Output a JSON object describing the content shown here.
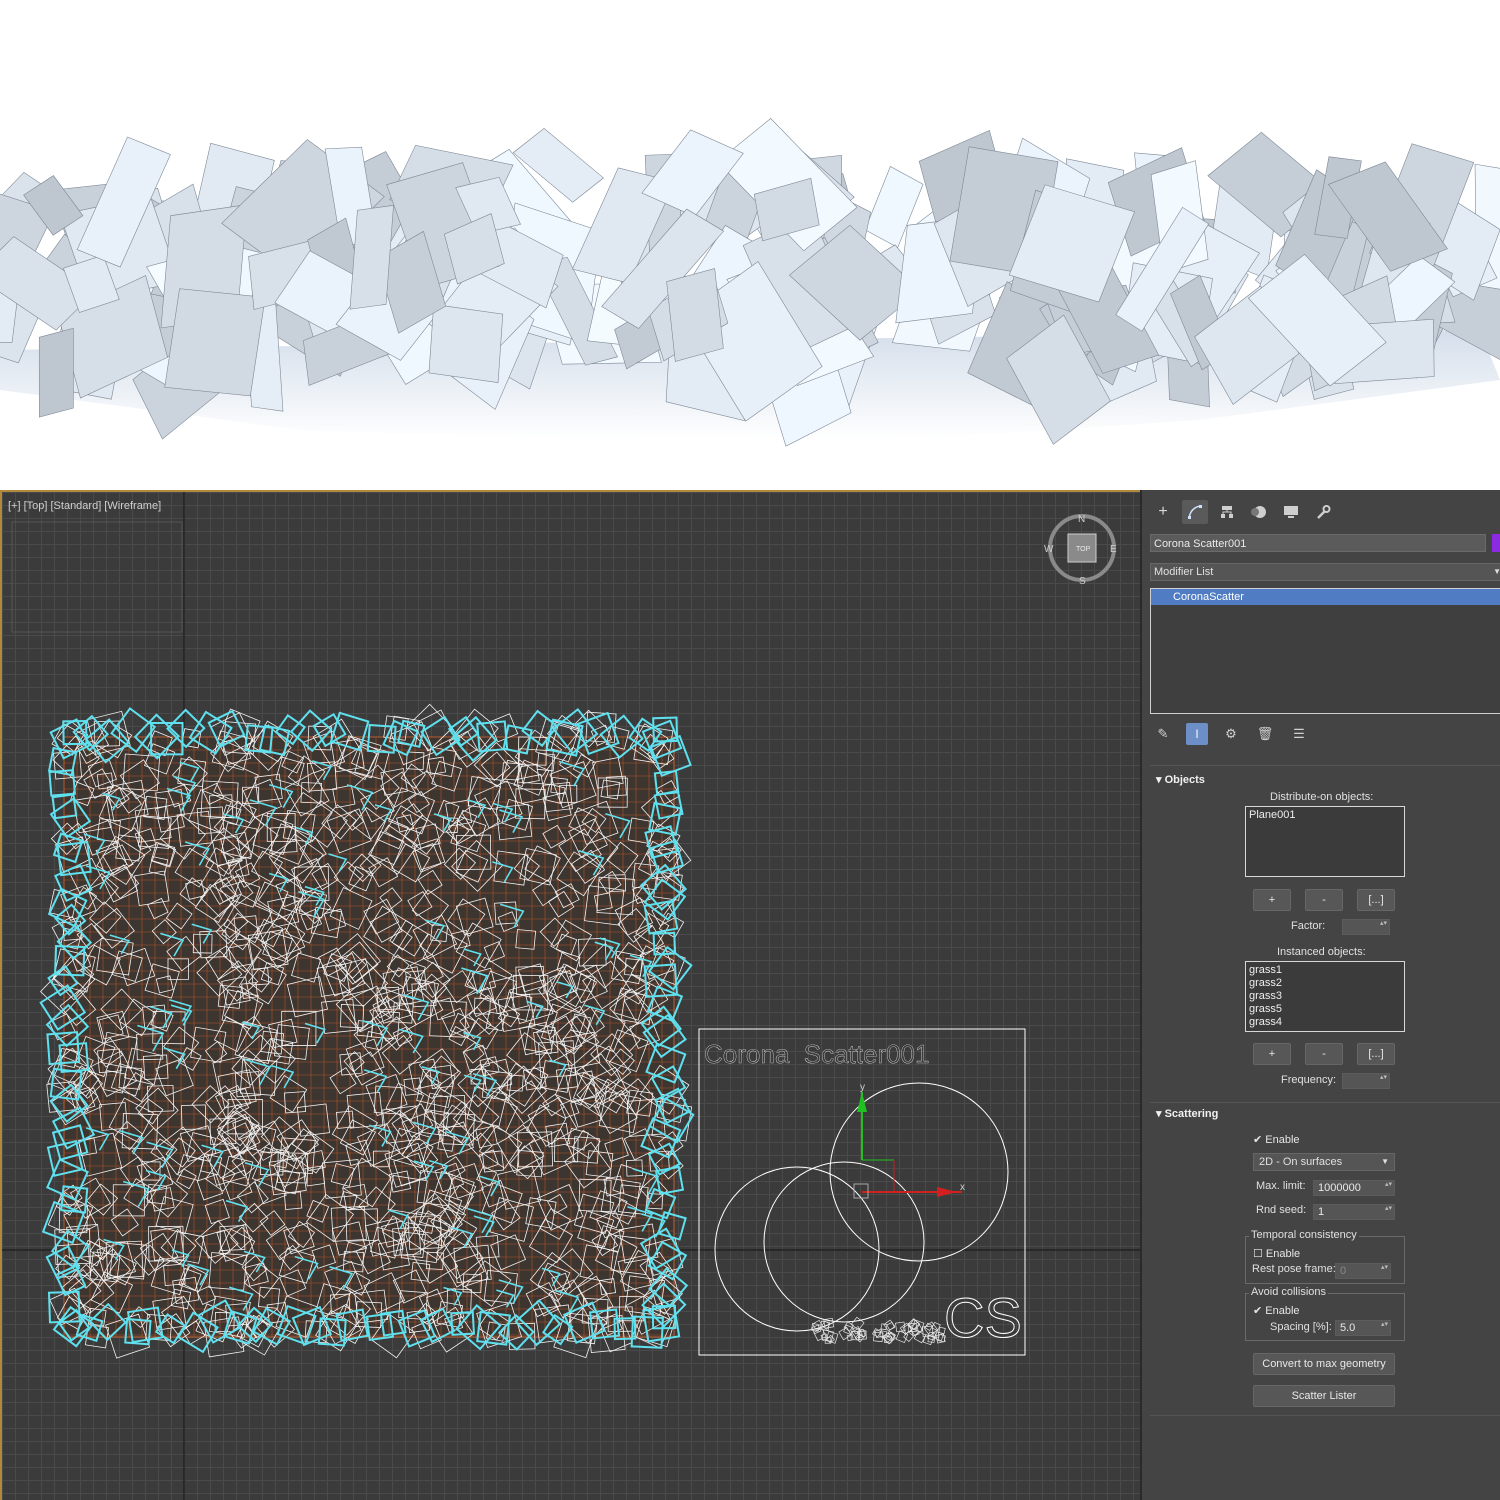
{
  "viewport": {
    "label": "[+] [Top] [Standard] [Wireframe]",
    "viewcube": {
      "n": "N",
      "s": "S",
      "e": "E",
      "w": "W",
      "face": "TOP"
    },
    "icon_title": "Corona  Scatter001",
    "icon_logo": "CS",
    "axis_x": "x",
    "axis_y": "y"
  },
  "panel": {
    "tabs": [
      "create-icon",
      "modify-icon",
      "hierarchy-icon",
      "motion-icon",
      "display-icon",
      "utilities-icon"
    ],
    "object_name": "Corona Scatter001",
    "object_color": "#8a2be2",
    "modifier_list": "Modifier List",
    "stack_item": "CoronaScatter",
    "objects": {
      "title": "Objects",
      "distribute_label": "Distribute-on objects:",
      "distribute_items": [
        "Plane001"
      ],
      "btn_add": "+",
      "btn_remove": "-",
      "btn_list": "[...]",
      "factor_label": "Factor:",
      "instanced_label": "Instanced objects:",
      "instanced_items": [
        "grass1",
        "grass2",
        "grass3",
        "grass5",
        "grass4"
      ],
      "frequency_label": "Frequency:"
    },
    "scattering": {
      "title": "Scattering",
      "enable": "Enable",
      "mode": "2D - On surfaces",
      "max_limit_label": "Max. limit:",
      "max_limit": "1000000",
      "rnd_seed_label": "Rnd seed:",
      "rnd_seed": "1",
      "temporal_title": "Temporal consistency",
      "temporal_enable": "Enable",
      "rest_pose_label": "Rest pose frame:",
      "rest_pose": "0",
      "avoid_title": "Avoid collisions",
      "avoid_enable": "Enable",
      "spacing_label": "Spacing [%]:",
      "spacing": "5.0",
      "convert_btn": "Convert to max geometry",
      "lister_btn": "Scatter Lister"
    }
  }
}
